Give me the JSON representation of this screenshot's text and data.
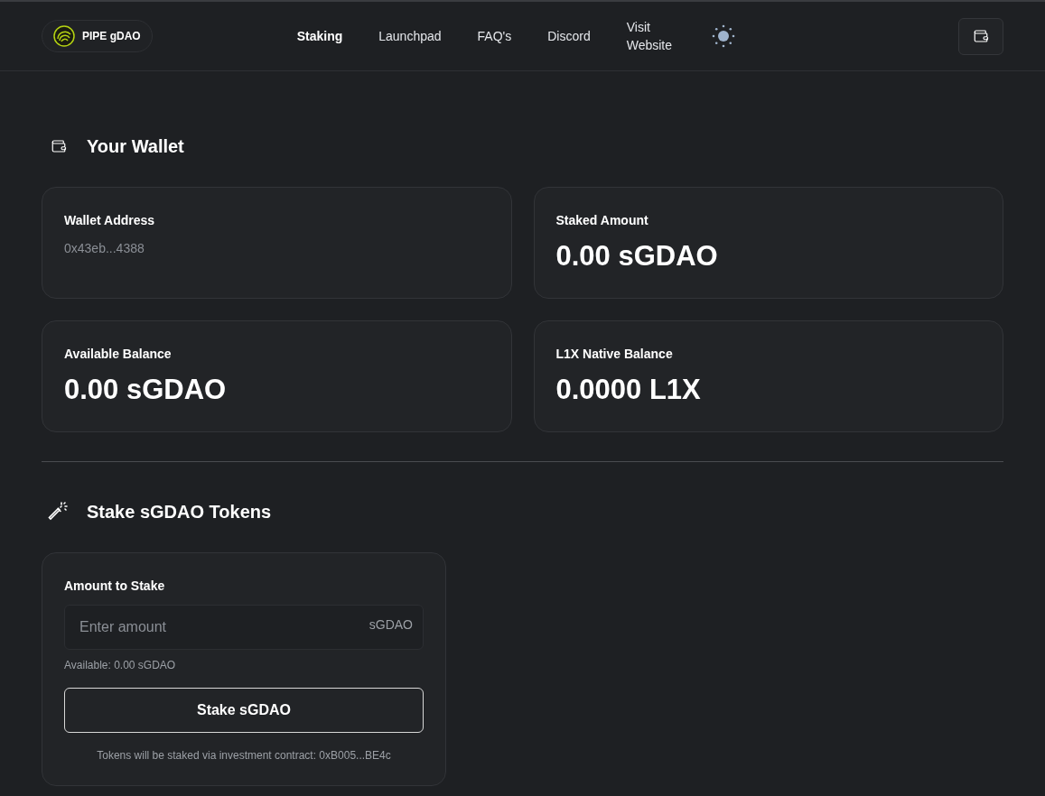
{
  "brand": {
    "name": "PIPE gDAO"
  },
  "nav": [
    {
      "label": "Staking",
      "selected": true
    },
    {
      "label": "Launchpad",
      "selected": false
    },
    {
      "label": "FAQ's",
      "selected": false
    },
    {
      "label": "Discord",
      "selected": false
    },
    {
      "label": "Visit Website",
      "selected": false
    }
  ],
  "wallet_section": {
    "title": "Your Wallet",
    "cards": [
      {
        "kind": "address",
        "label": "Wallet Address",
        "value": "0x43eb...4388"
      },
      {
        "kind": "amount",
        "label": "Staked Amount",
        "value": "0.00 sGDAO"
      },
      {
        "kind": "amount",
        "label": "Available Balance",
        "value": "0.00 sGDAO"
      },
      {
        "kind": "amount",
        "label": "L1X Native Balance",
        "value": "0.0000 L1X"
      }
    ]
  },
  "stake_section": {
    "title": "Stake sGDAO Tokens",
    "field_label": "Amount to Stake",
    "placeholder": "Enter amount",
    "unit": "sGDAO",
    "available": "Available: 0.00 sGDAO",
    "button": "Stake sGDAO",
    "note": "Tokens will be staked via investment contract: 0xB005...BE4c"
  }
}
